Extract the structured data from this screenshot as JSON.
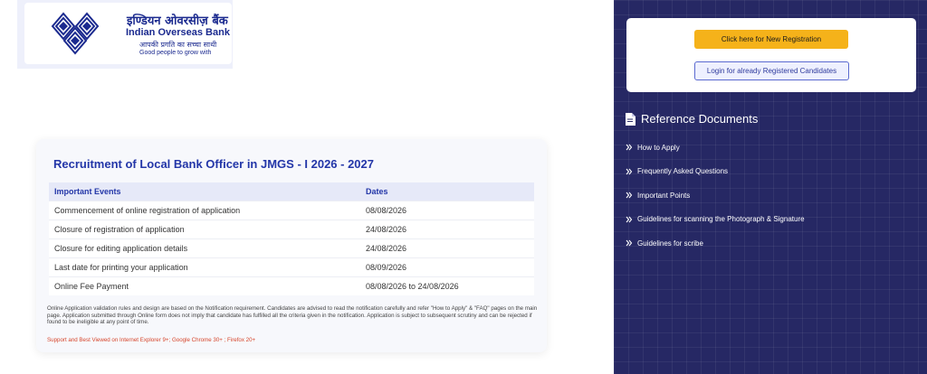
{
  "logo": {
    "hindi_name": "इण्डियन ओवरसीज़ बैंक",
    "english_name": "Indian Overseas Bank",
    "hindi_tagline": "आपकी प्रगति का सच्चा साथी",
    "tagline": "Good people to grow with"
  },
  "recruitment": {
    "title": "Recruitment of Local Bank Officer in JMGS - I 2026 - 2027",
    "headers": [
      "Important Events",
      "Dates"
    ],
    "rows": [
      [
        "Commencement of online registration of application",
        "08/08/2026"
      ],
      [
        "Closure of registration of application",
        "24/08/2026"
      ],
      [
        "Closure for editing application details",
        "24/08/2026"
      ],
      [
        "Last date for printing your application",
        "08/09/2026"
      ],
      [
        "Online Fee Payment",
        "08/08/2026 to 24/08/2026"
      ]
    ],
    "note": "Online Application validation rules and design are based on the Notification requirement. Candidates are advised to read the notification carefully and refer \"How to Apply\" & \"FAQ\" pages on the main page. Application submitted through Online form does not imply that candidate has fulfilled all the criteria given in the notification. Application is subject to subsequent scrutiny and can be rejected if found to be ineligible at any point of time.",
    "support": "Support and Best Viewed on Internet Explorer 9+; Google Chrome 30+ ; Firefox 20+"
  },
  "registration": {
    "new_label": "Click here for New Registration",
    "login_label": "Login for already Registered Candidates"
  },
  "reference": {
    "title": "Reference Documents",
    "icon": "document-icon",
    "items": [
      "How to Apply",
      "Frequently Asked Questions",
      "Important Points",
      "Guidelines for scanning the Photograph & Signature",
      "Guidelines for scribe"
    ]
  },
  "colors": {
    "brand_blue": "#1b2a8f",
    "panel_bg": "#262864",
    "accent_yellow": "#f5b21a",
    "support_red": "#d6452b"
  }
}
